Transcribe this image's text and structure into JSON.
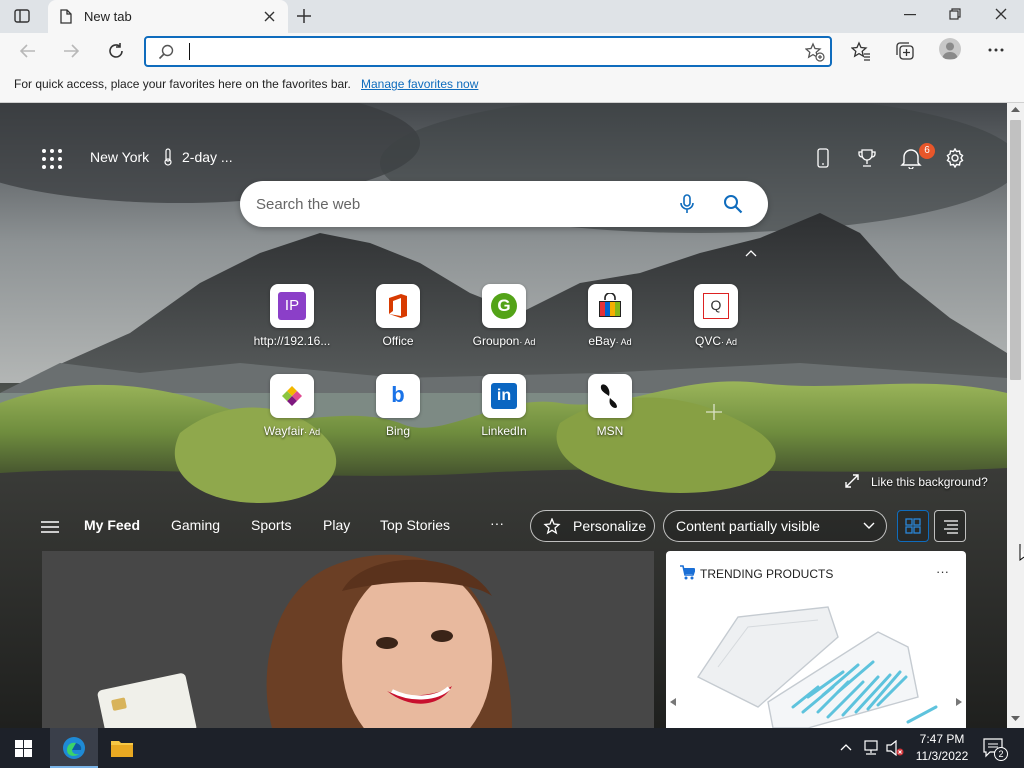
{
  "tab": {
    "title": "New tab"
  },
  "favbar": {
    "message": "For quick access, place your favorites here on the favorites bar.",
    "link": "Manage favorites now"
  },
  "ntp": {
    "location": "New York",
    "weather": "2-day ...",
    "notification_count": "6",
    "search_placeholder": "Search the web",
    "quick_links": [
      {
        "label": "http://192.16...",
        "icon": "IP"
      },
      {
        "label": "Office",
        "icon": "office-icon"
      },
      {
        "label": "Groupon",
        "ad": "· Ad",
        "icon": "G"
      },
      {
        "label": "eBay",
        "ad": "· Ad",
        "icon": "ebay-bag-icon"
      },
      {
        "label": "QVC",
        "ad": "· Ad",
        "icon": "Q"
      },
      {
        "label": "Wayfair",
        "ad": "· Ad",
        "icon": "wayfair-icon"
      },
      {
        "label": "Bing",
        "icon": "b"
      },
      {
        "label": "LinkedIn",
        "icon": "in"
      },
      {
        "label": "MSN",
        "icon": "msn-butterfly-icon"
      }
    ],
    "like_background": "Like this background?",
    "feed_nav": [
      "My Feed",
      "Gaming",
      "Sports",
      "Play",
      "Top Stories"
    ],
    "more": "···",
    "personalize": "Personalize",
    "content_visibility": "Content partially visible",
    "trending_title": "TRENDING PRODUCTS",
    "trending_more": "···"
  },
  "taskbar": {
    "time": "7:47 PM",
    "date": "11/3/2022",
    "notification_count": "2"
  },
  "colors": {
    "accent": "#0f6cbd",
    "tabstrip": "#dfe3e7",
    "toolbar": "#f7f7f7",
    "taskbar": "#1d2129",
    "badge": "#e8562a"
  }
}
